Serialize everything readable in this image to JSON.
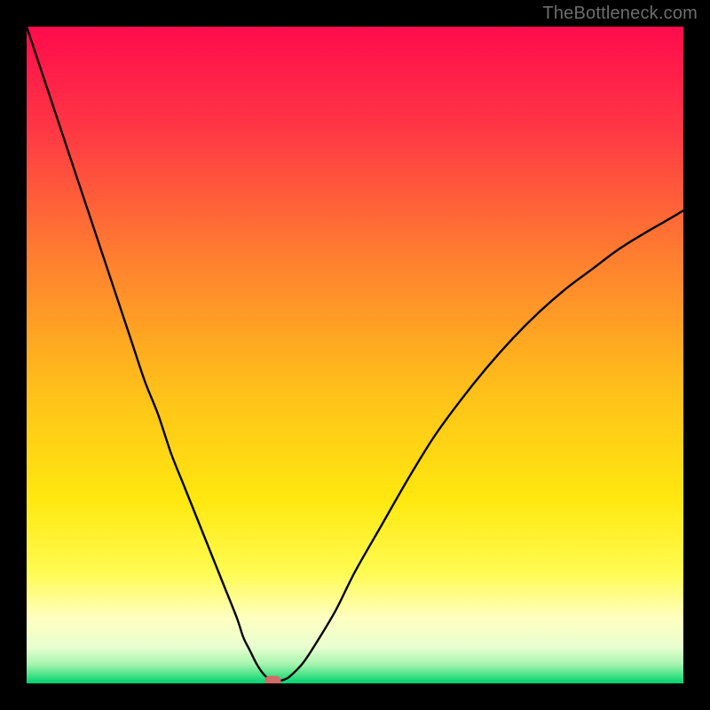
{
  "watermark": "TheBottleneck.com",
  "chart_data": {
    "type": "line",
    "title": "",
    "xlabel": "",
    "ylabel": "",
    "xlim": [
      0,
      100
    ],
    "ylim": [
      0,
      100
    ],
    "grid": false,
    "legend": false,
    "background": {
      "type": "vertical-gradient",
      "stops": [
        {
          "pos": 0.0,
          "color": "#ff0b4c"
        },
        {
          "pos": 0.15,
          "color": "#ff3545"
        },
        {
          "pos": 0.35,
          "color": "#ff7e30"
        },
        {
          "pos": 0.55,
          "color": "#ffbf1a"
        },
        {
          "pos": 0.72,
          "color": "#ffe80f"
        },
        {
          "pos": 0.83,
          "color": "#fffb50"
        },
        {
          "pos": 0.9,
          "color": "#ffffc0"
        },
        {
          "pos": 0.945,
          "color": "#e8ffd0"
        },
        {
          "pos": 0.97,
          "color": "#a8f5b0"
        },
        {
          "pos": 0.985,
          "color": "#55e58c"
        },
        {
          "pos": 1.0,
          "color": "#00d270"
        }
      ]
    },
    "series": [
      {
        "name": "bottleneck-curve",
        "color": "#000000",
        "x": [
          0,
          2,
          4,
          6,
          8,
          10,
          12,
          14,
          16,
          18,
          20,
          22,
          24,
          26,
          28,
          30,
          32,
          33,
          34,
          35,
          36,
          37,
          38,
          39,
          40,
          42,
          44,
          47,
          50,
          54,
          58,
          62,
          66,
          70,
          74,
          78,
          82,
          86,
          90,
          94,
          98,
          100
        ],
        "y": [
          100,
          94,
          88,
          82,
          76,
          70,
          64,
          58,
          52,
          46,
          41,
          35,
          30,
          25,
          20,
          15,
          10,
          7,
          5,
          3,
          1.5,
          0.6,
          0.3,
          0.5,
          1,
          3,
          6,
          11,
          17,
          24,
          31,
          37.5,
          43,
          48,
          52.5,
          56.5,
          60,
          63,
          66,
          68.5,
          70.8,
          72
        ]
      }
    ],
    "marker": {
      "name": "optimal-point",
      "x": 37.5,
      "y": 0.4,
      "color": "#d36a6a",
      "shape": "rounded-rect"
    }
  }
}
